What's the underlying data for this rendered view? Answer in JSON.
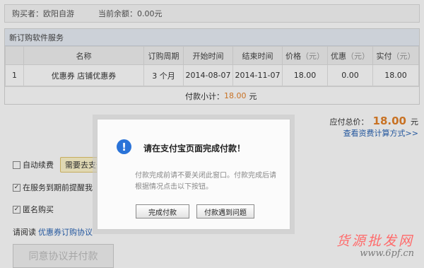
{
  "buyer": {
    "buyer_label": "购买者：欧阳自游",
    "balance_label": "当前余额：0.00元"
  },
  "section": {
    "title": "新订购软件服务",
    "columns": [
      "",
      "名称",
      "订购周期",
      "开始时间",
      "结束时间",
      "价格",
      "（元）",
      "优惠",
      "（元）",
      "实付",
      "（元）"
    ],
    "row": {
      "index": "1",
      "name": "优惠券 店铺优惠券",
      "period": "3 个月",
      "start": "2014-08-07",
      "end": "2014-11-07",
      "price": "18.00",
      "discount": "0.00",
      "paid": "18.00"
    },
    "subtotal_label": "付款小计：",
    "subtotal_value": "18.00",
    "subtotal_unit": "元"
  },
  "total": {
    "label": "应付总价：",
    "amount": "18.00",
    "unit": "元",
    "fee_link": "查看资费计算方式>>"
  },
  "options": {
    "auto_renew": "自动续费",
    "auto_renew_tag": "需要去支付",
    "remind": "在服务到期前提醒我",
    "anonymous": "匿名购买",
    "read_prefix": "请阅读",
    "agreement_link": "优惠券订购协议",
    "agree_button": "同意协议并付款"
  },
  "modal": {
    "title": "请在支付宝页面完成付款！",
    "message": "付款完成前请不要关闭此窗口。付款完成后请根据情况点击以下按钮。",
    "done_button": "完成付款",
    "problem_button": "付款遇到问题"
  },
  "watermark": {
    "line1": "货源批发网",
    "line2": "www.6pf.cn"
  }
}
